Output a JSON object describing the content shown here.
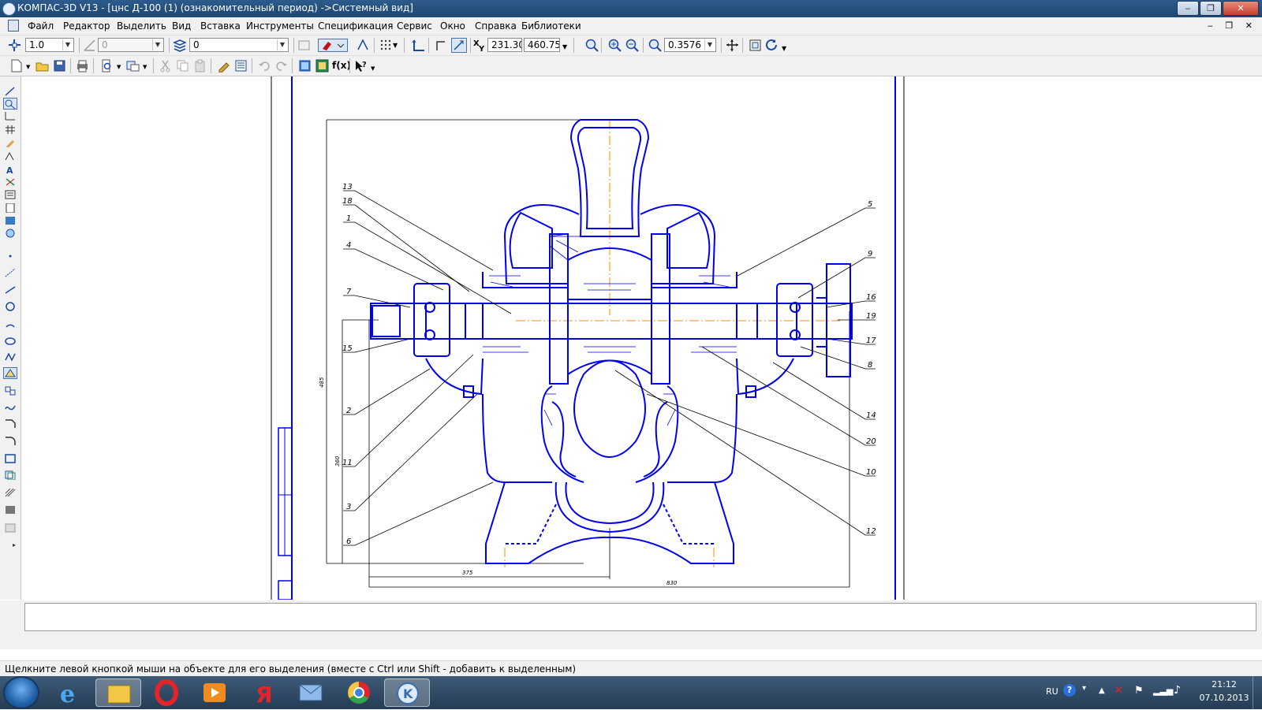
{
  "window": {
    "title": "КОМПАС-3D V13 - [цнс Д-100 (1) (ознакомительный период) ->Системный вид]",
    "minimize_glyph": "‒",
    "maximize_glyph": "❐",
    "close_glyph": "✕",
    "doc_controls": "‒ ❐ ✕"
  },
  "menu": [
    "Файл",
    "Редактор",
    "Выделить",
    "Вид",
    "Вставка",
    "Инструменты",
    "Спецификация",
    "Сервис",
    "Окно",
    "Справка",
    "Библиотеки"
  ],
  "toolbar": {
    "step": "1.0",
    "angle": "0",
    "layer": "0",
    "coord_x_label": "X",
    "coord_y_label": "Y",
    "coord_x": "231.30",
    "coord_y": "460.75",
    "zoom": "0.3576",
    "formula_label": "f(x)"
  },
  "drawing": {
    "labels_left": [
      "13",
      "18",
      "1",
      "4",
      "7",
      "15",
      "2",
      "11",
      "3",
      "6"
    ],
    "labels_right": [
      "5",
      "9",
      "16",
      "19",
      "17",
      "8",
      "14",
      "20",
      "10",
      "12"
    ],
    "dim_width_left": "375",
    "dim_width_total": "830",
    "dim_height_total": "485",
    "dim_height_axis": "360"
  },
  "status": {
    "message": "Щелкните левой кнопкой мыши на объекте для его выделения (вместе с Ctrl или Shift - добавить к выделенным)"
  },
  "taskbar": {
    "lang": "RU",
    "time": "21:12",
    "date": "07.10.2013",
    "apps": [
      "internet-explorer",
      "file-explorer",
      "opera",
      "media-player",
      "yandex",
      "mail",
      "chrome",
      "kompas"
    ]
  },
  "colors": {
    "drawing": "#0000ee",
    "axis": "#ff8c00",
    "annotation": "#000000",
    "titlebar": "#2d5b8d"
  }
}
